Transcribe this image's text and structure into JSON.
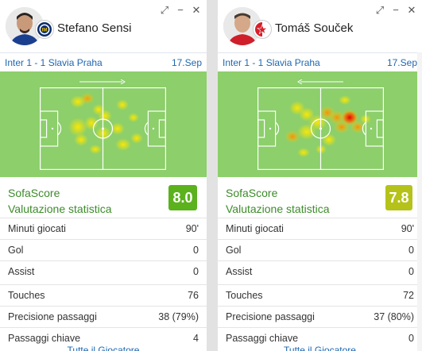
{
  "cards": [
    {
      "player_name": "Stefano Sensi",
      "team_badge_icon": "inter-logo-icon",
      "match": "Inter 1 - 1 Slavia Praha",
      "date": "17.Sep",
      "attack_direction": "right-arrow-icon",
      "sofa_line1": "SofaScore",
      "sofa_line2": "Valutazione statistica",
      "rating": "8.0",
      "rating_color": "#5bb21c",
      "stats": [
        {
          "label": "Minuti giocati",
          "value": "90'"
        },
        {
          "label": "Gol",
          "value": "0"
        },
        {
          "label": "Assist",
          "value": "0"
        },
        {
          "label": "Touches",
          "value": "76"
        },
        {
          "label": "Precisione passaggi",
          "value": "38 (79%)"
        },
        {
          "label": "Passaggi chiave",
          "value": "4"
        }
      ],
      "footer": "Tutte il Giocatore"
    },
    {
      "player_name": "Tomáš Souček",
      "team_badge_icon": "slavia-logo-icon",
      "match": "Inter 1 - 1 Slavia Praha",
      "date": "17.Sep",
      "attack_direction": "left-arrow-icon",
      "sofa_line1": "SofaScore",
      "sofa_line2": "Valutazione statistica",
      "rating": "7.8",
      "rating_color": "#b5c21a",
      "stats": [
        {
          "label": "Minuti giocati",
          "value": "90'"
        },
        {
          "label": "Gol",
          "value": "0"
        },
        {
          "label": "Assist",
          "value": "0"
        },
        {
          "label": "Touches",
          "value": "72"
        },
        {
          "label": "Precisione passaggi",
          "value": "37 (80%)"
        },
        {
          "label": "Passaggi chiave",
          "value": "0"
        }
      ],
      "footer": "Tutte il Giocatore"
    }
  ],
  "window_controls": {
    "expand": "⤢",
    "minimize": "−",
    "close": "✕"
  }
}
